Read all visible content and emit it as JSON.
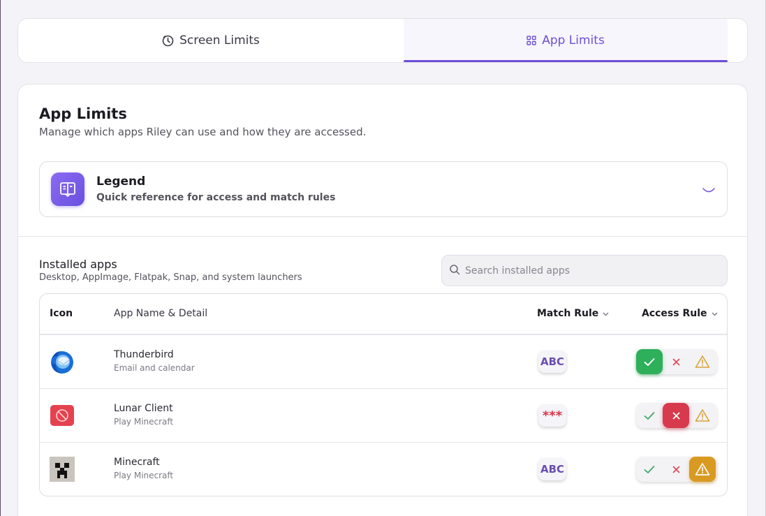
{
  "tabs": [
    {
      "label": "Screen Limits",
      "icon": "clock-icon",
      "active": false
    },
    {
      "label": "App Limits",
      "icon": "grid-icon",
      "active": true
    }
  ],
  "page": {
    "title": "App Limits",
    "subtitle": "Manage which apps Riley can use and how they are accessed."
  },
  "legend": {
    "title": "Legend",
    "subtitle": "Quick reference for access and match rules",
    "icon": "book-icon"
  },
  "installed": {
    "title": "Installed apps",
    "subtitle": "Desktop, AppImage, Flatpak, Snap, and system launchers",
    "search_placeholder": "Search installed apps"
  },
  "table": {
    "headers": {
      "icon": "Icon",
      "name": "App Name & Detail",
      "match": "Match Rule",
      "access": "Access Rule"
    },
    "rows": [
      {
        "name": "Thunderbird",
        "detail": "Email and calendar",
        "icon": "thunderbird-icon",
        "match": "ABC",
        "access": "allow"
      },
      {
        "name": "Lunar Client",
        "detail": "Play Minecraft",
        "icon": "lunar-client-icon",
        "match": "***",
        "access": "block"
      },
      {
        "name": "Minecraft",
        "detail": "Play Minecraft",
        "icon": "minecraft-icon",
        "match": "ABC",
        "access": "warn"
      }
    ]
  },
  "colors": {
    "accent": "#6d4fd8",
    "allow": "#2eaf5a",
    "block": "#d73a4c",
    "warn": "#d99a22"
  }
}
